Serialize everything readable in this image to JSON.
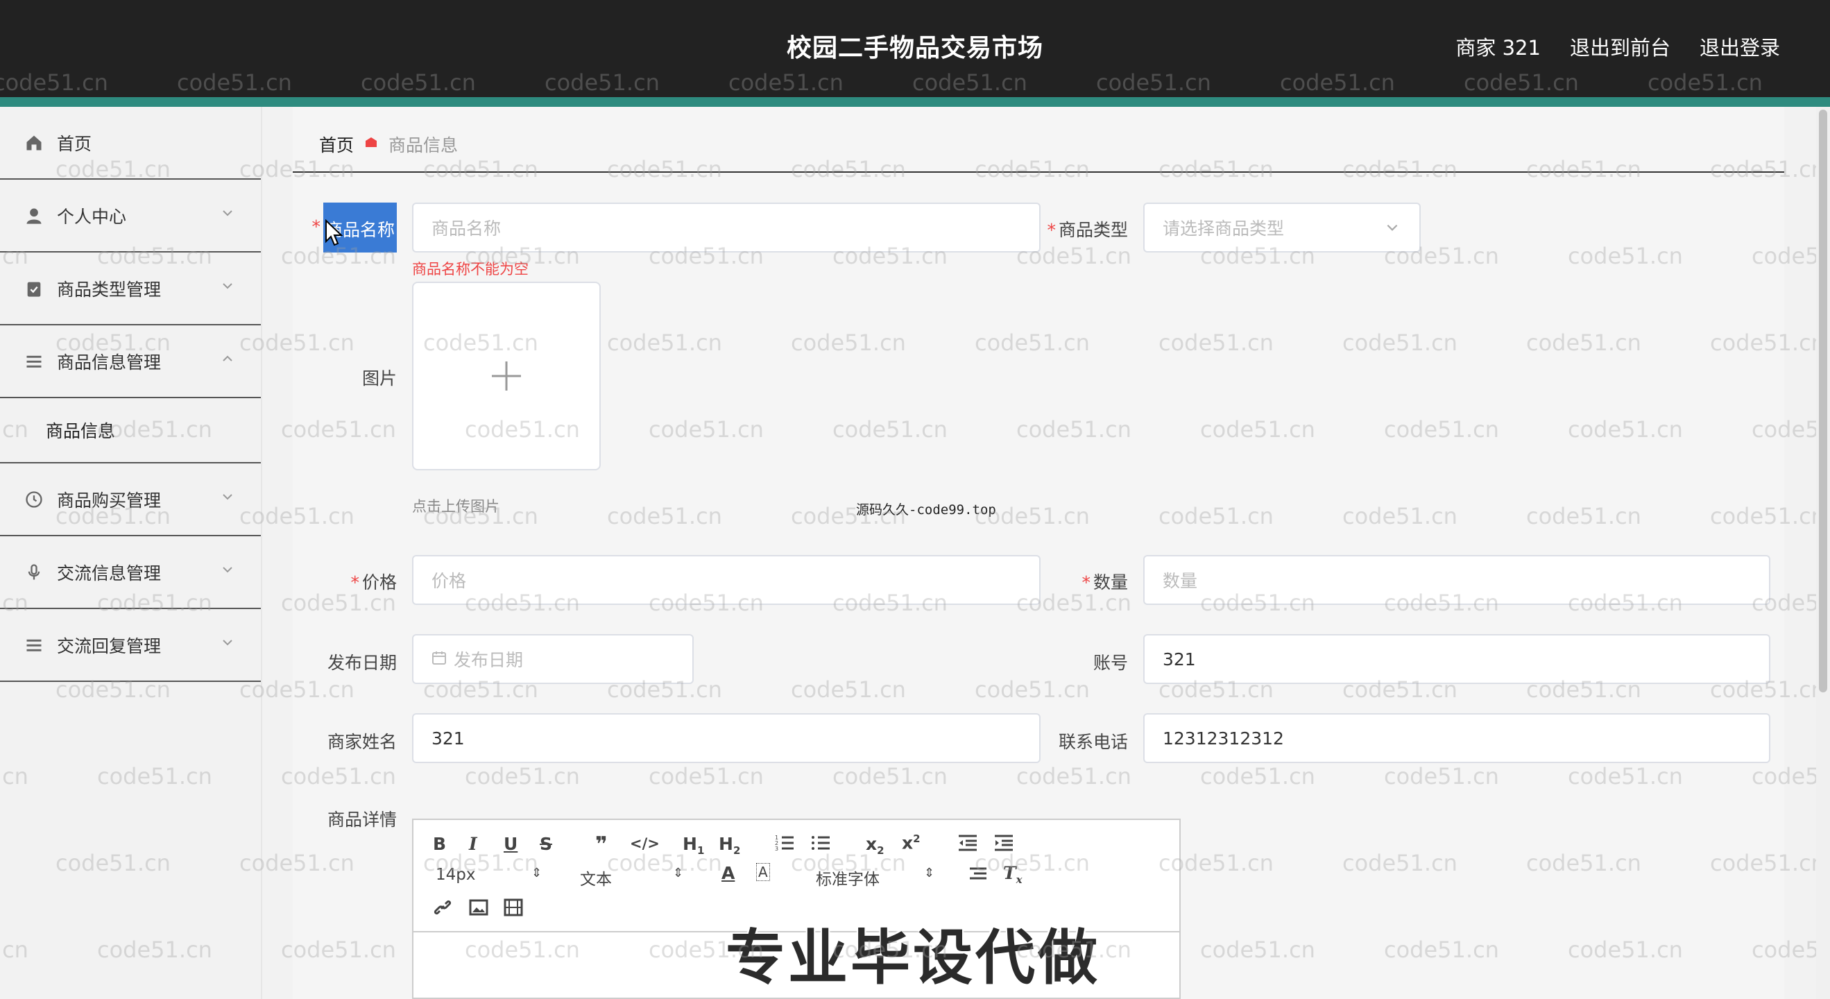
{
  "header": {
    "title": "校园二手物品交易市场",
    "user": "商家 321",
    "back_to_front": "退出到前台",
    "logout": "退出登录"
  },
  "sidebar": {
    "items": [
      {
        "label": "首页",
        "icon": "home-icon"
      },
      {
        "label": "个人中心",
        "icon": "user-icon"
      },
      {
        "label": "商品类型管理",
        "icon": "clipboard-icon"
      },
      {
        "label": "商品信息管理",
        "icon": "list-icon"
      },
      {
        "label": "商品购买管理",
        "icon": "clock-icon"
      },
      {
        "label": "交流信息管理",
        "icon": "mic-icon"
      },
      {
        "label": "交流回复管理",
        "icon": "list-icon"
      }
    ],
    "submenu_label": "商品信息"
  },
  "breadcrumb": {
    "home": "首页",
    "current": "商品信息"
  },
  "form": {
    "name_label": "商品名称",
    "name_placeholder": "商品名称",
    "name_error": "商品名称不能为空",
    "type_label": "商品类型",
    "type_placeholder": "请选择商品类型",
    "image_label": "图片",
    "upload_tip": "点击上传图片",
    "price_label": "价格",
    "price_placeholder": "价格",
    "qty_label": "数量",
    "qty_placeholder": "数量",
    "date_label": "发布日期",
    "date_placeholder": "发布日期",
    "account_label": "账号",
    "account_value": "321",
    "merchant_name_label": "商家姓名",
    "merchant_name_value": "321",
    "phone_label": "联系电话",
    "phone_value": "12312312312",
    "detail_label": "商品详情"
  },
  "editor": {
    "font_size": "14px",
    "text_type": "文本",
    "font_family": "标准字体"
  },
  "overlay": {
    "center_mark": "源码久久-code99.top",
    "big_text": "专业毕设代做",
    "watermark": "code51.cn"
  },
  "colors": {
    "header_bg": "#222222",
    "accent": "#2e8b7f",
    "required": "#ee4444",
    "selection": "#3a7bd5"
  }
}
